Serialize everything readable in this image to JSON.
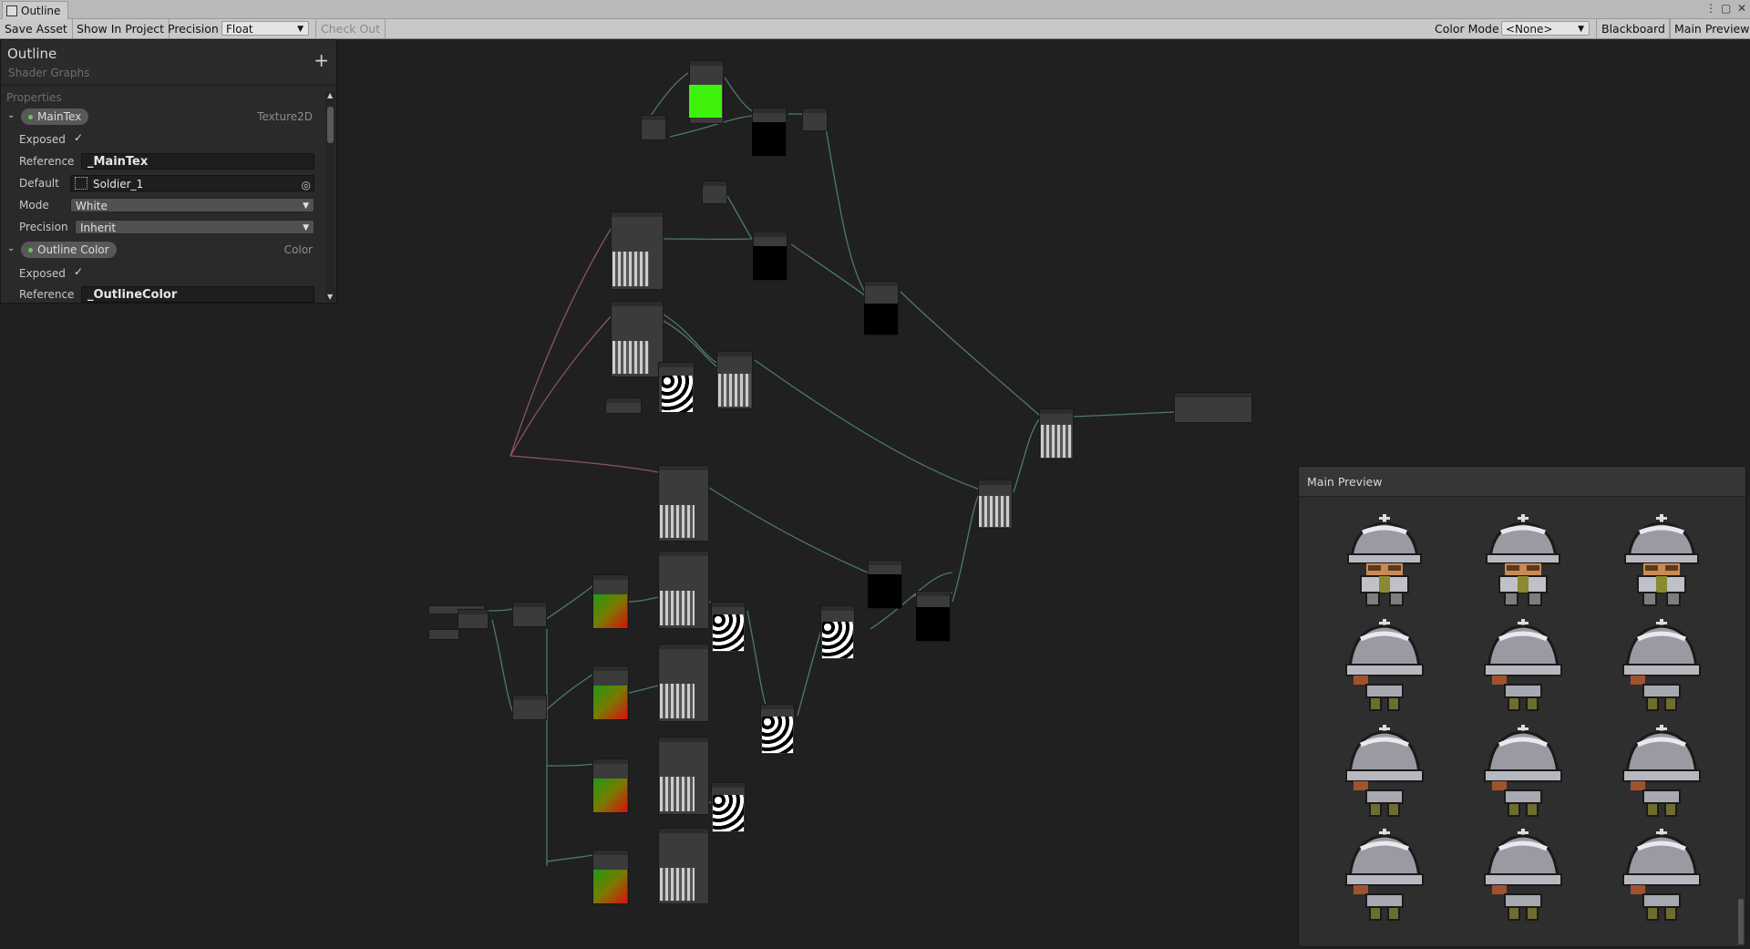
{
  "window": {
    "tab_title": "Outline",
    "controls": [
      "⋮",
      "▢",
      "✕"
    ]
  },
  "toolbar": {
    "save_asset": "Save Asset",
    "show_in_project": "Show In Project",
    "precision_label": "Precision",
    "precision_value": "Float",
    "check_out": "Check Out",
    "color_mode_label": "Color Mode",
    "color_mode_value": "<None>",
    "blackboard": "Blackboard",
    "main_preview": "Main Preview"
  },
  "blackboard": {
    "title": "Outline",
    "subtitle": "Shader Graphs",
    "add_icon": "+",
    "section": "Properties",
    "properties": [
      {
        "name": "MainTex",
        "type": "Texture2D",
        "exposed_label": "Exposed",
        "reference_label": "Reference",
        "reference_value": "_MainTex",
        "default_label": "Default",
        "default_value": "Soldier_1",
        "mode_label": "Mode",
        "mode_value": "White",
        "precision_label": "Precision",
        "precision_value": "Inherit"
      },
      {
        "name": "Outline Color",
        "type": "Color",
        "exposed_label": "Exposed",
        "reference_label": "Reference",
        "reference_value": "_OutlineColor"
      }
    ]
  },
  "main_preview": {
    "title": "Main Preview"
  },
  "colors": {
    "canvas_bg": "#202020",
    "node_bg": "#3b3b3b",
    "edge_green": "#4d7a6a",
    "edge_red": "#8a5560",
    "bright_green": "#3ef20e",
    "toolbar_bg": "#c8c8c8"
  },
  "icons": {
    "chevron": "chevron-down-icon",
    "check": "checkmark-icon",
    "texture": "texture-icon",
    "object_picker": "object-picker-icon",
    "add": "plus-icon"
  }
}
